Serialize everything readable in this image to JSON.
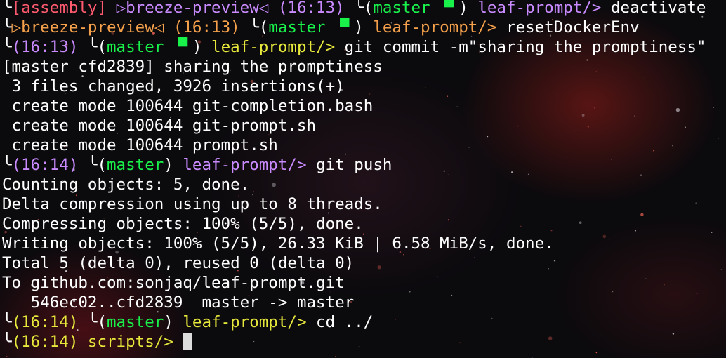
{
  "terminal": {
    "lines": [
      {
        "segments": [
          {
            "text": "╰",
            "color": "white"
          },
          {
            "text": "[assembly] ",
            "color": "assembly"
          },
          {
            "text": "▷breeze-preview◁ ",
            "color": "breeze-purple"
          },
          {
            "text": "(16:13) ",
            "color": "time-purple"
          },
          {
            "text": "╰(",
            "color": "white"
          },
          {
            "text": "master ▝▘",
            "color": "branch"
          },
          {
            "text": ") ",
            "color": "white"
          },
          {
            "text": "leaf-prompt/>",
            "color": "dir-purple"
          },
          {
            "text": " deactivate",
            "color": "white"
          }
        ]
      },
      {
        "segments": [
          {
            "text": "╰",
            "color": "white"
          },
          {
            "text": "▷breeze-preview◁ ",
            "color": "breeze-orange"
          },
          {
            "text": "(16:13) ",
            "color": "time-orange"
          },
          {
            "text": "╰(",
            "color": "white"
          },
          {
            "text": "master ▝▘",
            "color": "branch"
          },
          {
            "text": ") ",
            "color": "white"
          },
          {
            "text": "leaf-prompt/>",
            "color": "dir-orange"
          },
          {
            "text": " resetDockerEnv",
            "color": "white"
          }
        ]
      },
      {
        "segments": [
          {
            "text": "╰",
            "color": "white"
          },
          {
            "text": "(16:13) ",
            "color": "time-purple"
          },
          {
            "text": "╰(",
            "color": "white"
          },
          {
            "text": "master ▝▘",
            "color": "branch"
          },
          {
            "text": ") ",
            "color": "white"
          },
          {
            "text": "leaf-prompt/>",
            "color": "dir-yellow"
          },
          {
            "text": " git commit -m\"sharing the promptiness\"",
            "color": "white"
          }
        ]
      },
      {
        "segments": [
          {
            "text": "[master cfd2839] sharing the promptiness",
            "color": "white"
          }
        ]
      },
      {
        "segments": [
          {
            "text": " 3 files changed, 3926 insertions(+)",
            "color": "white"
          }
        ]
      },
      {
        "segments": [
          {
            "text": " create mode 100644 git-completion.bash",
            "color": "white"
          }
        ]
      },
      {
        "segments": [
          {
            "text": " create mode 100644 git-prompt.sh",
            "color": "white"
          }
        ]
      },
      {
        "segments": [
          {
            "text": " create mode 100644 prompt.sh",
            "color": "white"
          }
        ]
      },
      {
        "segments": [
          {
            "text": "╰",
            "color": "white"
          },
          {
            "text": "(16:14) ",
            "color": "time-purple"
          },
          {
            "text": "╰(",
            "color": "white"
          },
          {
            "text": "master",
            "color": "branch"
          },
          {
            "text": ") ",
            "color": "white"
          },
          {
            "text": "leaf-prompt/>",
            "color": "dir-purple"
          },
          {
            "text": " git push",
            "color": "white"
          }
        ]
      },
      {
        "segments": [
          {
            "text": "Counting objects: 5, done.",
            "color": "white"
          }
        ]
      },
      {
        "segments": [
          {
            "text": "Delta compression using up to 8 threads.",
            "color": "white"
          }
        ]
      },
      {
        "segments": [
          {
            "text": "Compressing objects: 100% (5/5), done.",
            "color": "white"
          }
        ]
      },
      {
        "segments": [
          {
            "text": "Writing objects: 100% (5/5), 26.33 KiB | 6.58 MiB/s, done.",
            "color": "white"
          }
        ]
      },
      {
        "segments": [
          {
            "text": "Total 5 (delta 0), reused 0 (delta 0)",
            "color": "white"
          }
        ]
      },
      {
        "segments": [
          {
            "text": "To github.com:sonjaq/leaf-prompt.git",
            "color": "white"
          }
        ]
      },
      {
        "segments": [
          {
            "text": "   546ec02..cfd2839  master -> master",
            "color": "white"
          }
        ]
      },
      {
        "segments": [
          {
            "text": "╰",
            "color": "white"
          },
          {
            "text": "(16:14) ",
            "color": "time-yellow"
          },
          {
            "text": "╰(",
            "color": "white"
          },
          {
            "text": "master",
            "color": "branch"
          },
          {
            "text": ") ",
            "color": "white"
          },
          {
            "text": "leaf-prompt/>",
            "color": "dir-yellow"
          },
          {
            "text": " cd ../",
            "color": "white"
          }
        ]
      },
      {
        "segments": [
          {
            "text": "╰",
            "color": "white"
          },
          {
            "text": "(16:14) ",
            "color": "time-yellow"
          },
          {
            "text": "scripts/>",
            "color": "dir-yellow"
          },
          {
            "text": " ",
            "color": "white"
          }
        ],
        "cursor": true
      }
    ]
  },
  "colors": {
    "background": "#0b0a0d",
    "text": "#ffffff",
    "branch": "#19f24a",
    "purple": "#c98bff",
    "orange": "#f5a14b",
    "yellow": "#e7e83c",
    "assembly": "#ff5a6e",
    "cursor": "#dcdcdc"
  }
}
